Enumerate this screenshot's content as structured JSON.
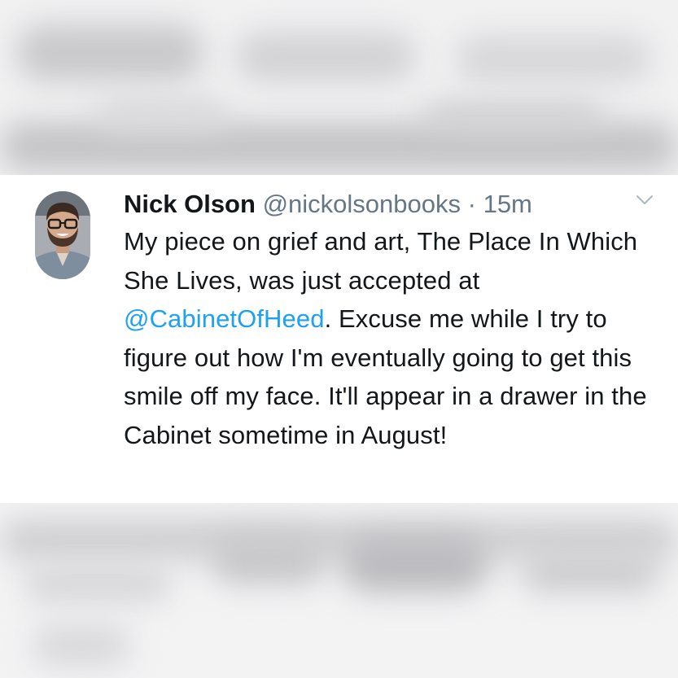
{
  "tweet": {
    "author": {
      "display_name": "Nick Olson",
      "handle": "@nickolsonbooks"
    },
    "separator": "·",
    "timestamp": "15m",
    "text_before_mention": "My piece on grief and art, The Place In Which She Lives, was just accepted at ",
    "mention": "@CabinetOfHeed",
    "text_after_mention": ". Excuse me while I try to figure out how I'm eventually going to get this smile off my face. It'll appear in a drawer in the Cabinet sometime in August!"
  },
  "icons": {
    "menu": "chevron-down-icon"
  },
  "colors": {
    "text": "#14171a",
    "secondary_text": "#657786",
    "link": "#1da1f2",
    "card_background": "#ffffff"
  }
}
